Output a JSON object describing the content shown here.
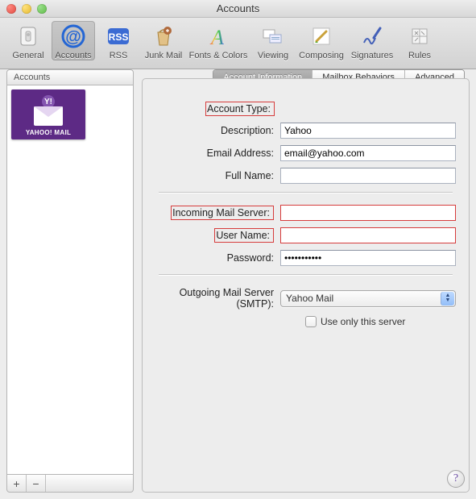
{
  "window": {
    "title": "Accounts"
  },
  "toolbar": {
    "items": [
      {
        "label": "General"
      },
      {
        "label": "Accounts"
      },
      {
        "label": "RSS"
      },
      {
        "label": "Junk Mail"
      },
      {
        "label": "Fonts & Colors"
      },
      {
        "label": "Viewing"
      },
      {
        "label": "Composing"
      },
      {
        "label": "Signatures"
      },
      {
        "label": "Rules"
      }
    ]
  },
  "sidebar": {
    "header": "Accounts",
    "accounts": [
      {
        "name": "YAHOO! MAIL",
        "badge": "Y!"
      }
    ],
    "add_glyph": "+",
    "remove_glyph": "−"
  },
  "tabs": {
    "t0": "Account Information",
    "t1": "Mailbox Behaviors",
    "t2": "Advanced"
  },
  "form": {
    "account_type_label": "Account Type:",
    "account_type_value": "",
    "description_label": "Description:",
    "description_value": "Yahoo",
    "email_label": "Email Address:",
    "email_value": "email@yahoo.com",
    "fullname_label": "Full Name:",
    "fullname_value": "",
    "incoming_label": "Incoming Mail Server:",
    "incoming_value": "",
    "username_label": "User Name:",
    "username_value": "",
    "password_label": "Password:",
    "password_value": "•••••••••••",
    "smtp_label": "Outgoing Mail Server (SMTP):",
    "smtp_value": "Yahoo Mail",
    "use_only_label": "Use only this server"
  },
  "help_glyph": "?"
}
